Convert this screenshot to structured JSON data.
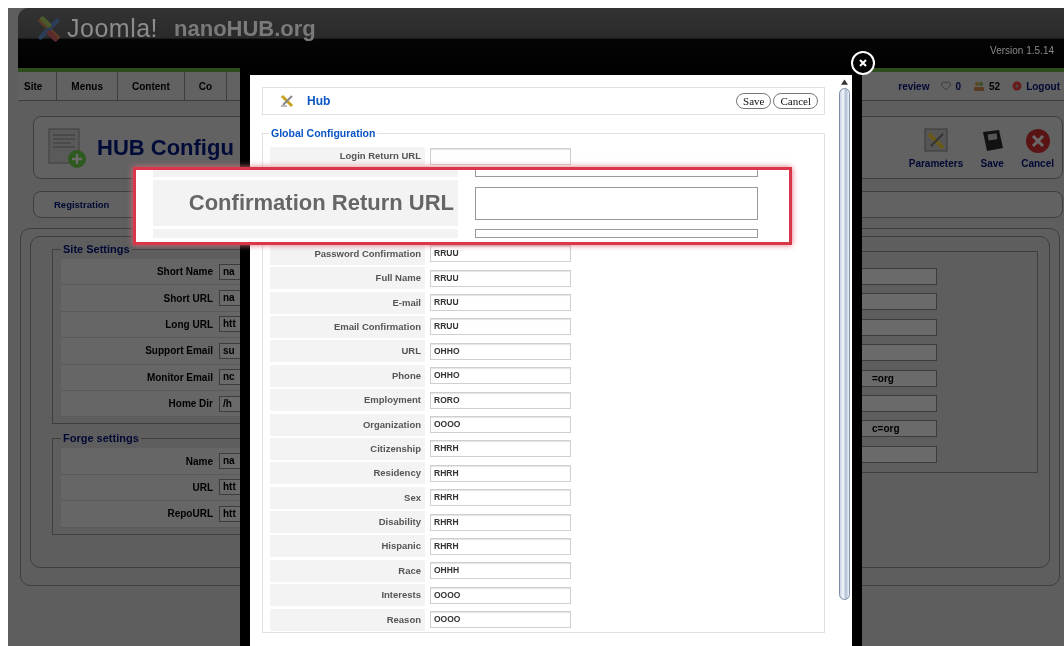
{
  "admin": {
    "header": {
      "brand": "Joomla!",
      "site_name": "nanoHUB.org",
      "version": "Version 1.5.14"
    },
    "menu": [
      "Site",
      "Menus",
      "Content",
      "Co"
    ],
    "status": {
      "preview": "review",
      "messages": "0",
      "users": "52",
      "logout": "Logout"
    },
    "toolbar": {
      "title": "HUB Configu",
      "buttons": [
        {
          "kind": "parameters",
          "label": "Parameters"
        },
        {
          "kind": "save",
          "label": "Save"
        },
        {
          "kind": "cancel",
          "label": "Cancel"
        }
      ]
    },
    "tabs": [
      {
        "label": "Registration",
        "selected": false
      }
    ],
    "site_settings": {
      "legend": "Site Settings",
      "rows": [
        {
          "label": "Short Name",
          "value": "na"
        },
        {
          "label": "Short URL",
          "value": "na"
        },
        {
          "label": "Long URL",
          "value": "htt"
        },
        {
          "label": "Support Email",
          "value": "su"
        },
        {
          "label": "Monitor Email",
          "value": "nc"
        },
        {
          "label": "Home Dir",
          "value": "/h"
        }
      ]
    },
    "forge_settings": {
      "legend": "Forge settings",
      "rows": [
        {
          "label": "Name",
          "value": "na"
        },
        {
          "label": "URL",
          "value": "htt"
        },
        {
          "label": "RepoURL",
          "value": "htt"
        }
      ]
    },
    "right_panel": {
      "fields": [
        {
          "kind": "empty"
        },
        {
          "kind": "empty"
        },
        {
          "kind": "empty"
        },
        {
          "kind": "empty"
        },
        {
          "kind": "text",
          "value": "=org"
        },
        {
          "kind": "empty"
        },
        {
          "kind": "text",
          "value": "c=org"
        },
        {
          "kind": "empty"
        }
      ]
    }
  },
  "modal": {
    "title": "Hub",
    "buttons": [
      "Save",
      "Cancel"
    ],
    "fieldset": {
      "legend": "Global Configuration",
      "rows": [
        {
          "label": "Login Return URL"
        },
        {
          "label": "Password Confirmation",
          "value": "RRUU"
        },
        {
          "label": "Full Name",
          "value": "RRUU"
        },
        {
          "label": "E-mail",
          "value": "RRUU"
        },
        {
          "label": "Email Confirmation",
          "value": "RRUU"
        },
        {
          "label": "URL",
          "value": "OHHO"
        },
        {
          "label": "Phone",
          "value": "OHHO"
        },
        {
          "label": "Employment",
          "value": "RORO"
        },
        {
          "label": "Organization",
          "value": "OOOO"
        },
        {
          "label": "Citizenship",
          "value": "RHRH"
        },
        {
          "label": "Residency",
          "value": "RHRH"
        },
        {
          "label": "Sex",
          "value": "RHRH"
        },
        {
          "label": "Disability",
          "value": "RHRH"
        },
        {
          "label": "Hispanic",
          "value": "RHRH"
        },
        {
          "label": "Race",
          "value": "OHHH"
        },
        {
          "label": "Interests",
          "value": "OOOO"
        },
        {
          "label": "Reason",
          "value": "OOOO"
        }
      ]
    }
  },
  "callout": {
    "label": "Confirmation Return URL"
  }
}
